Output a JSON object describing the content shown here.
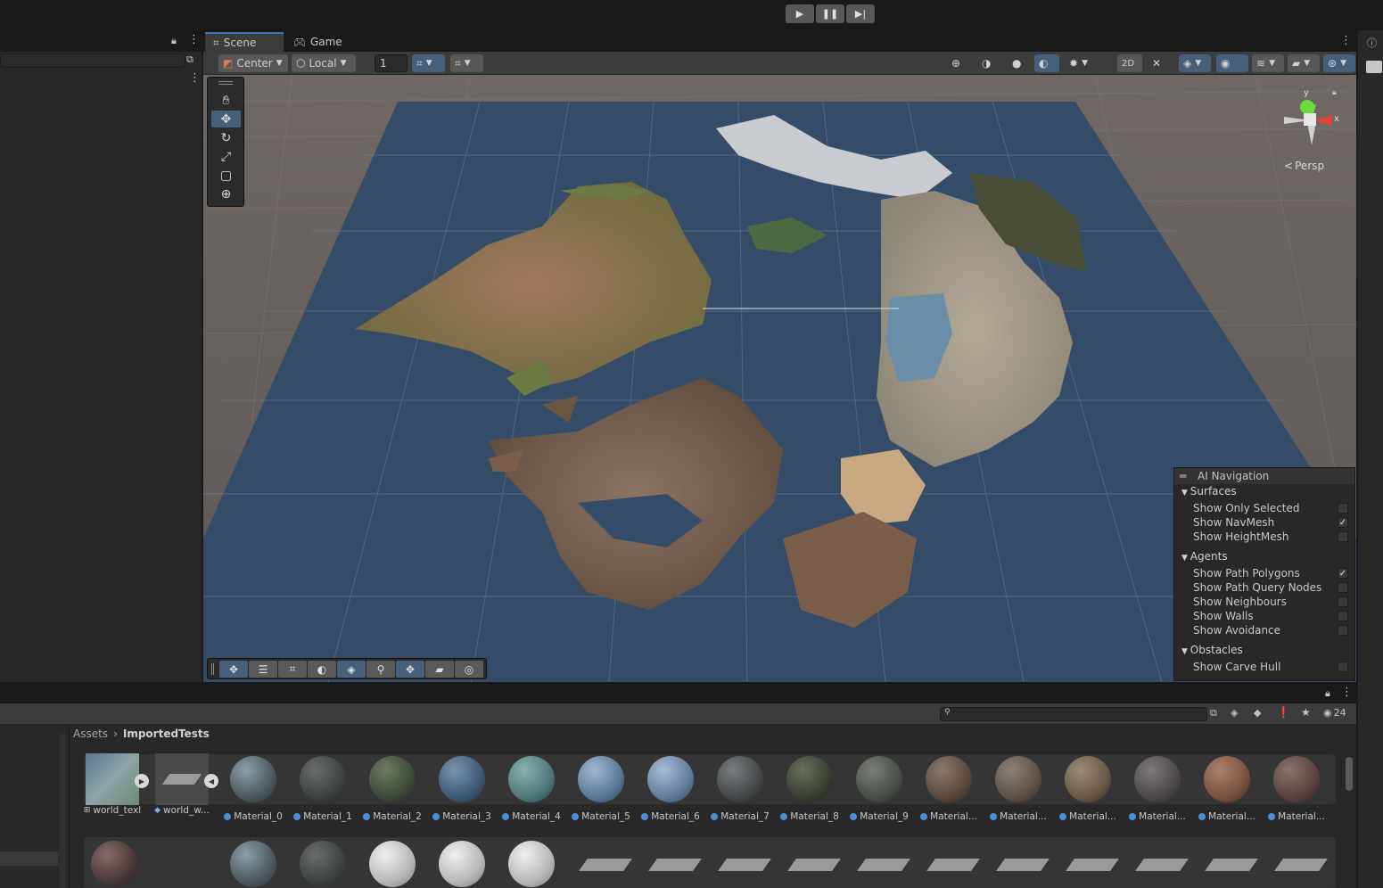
{
  "playbar": {
    "play": "▶",
    "pause": "❚❚",
    "step": "▶|"
  },
  "scene_tabs": [
    {
      "label": "Scene",
      "icon": "grid-icon"
    },
    {
      "label": "Game",
      "icon": "gamepad-icon"
    }
  ],
  "scene_toolbar": {
    "pivot": "Center",
    "space": "Local",
    "grid_value": "1"
  },
  "viewport": {
    "projection_label": "Persp",
    "axis_x": "x",
    "axis_y": "y"
  },
  "ai_navigation": {
    "title": "AI Navigation",
    "sections": [
      {
        "title": "Surfaces",
        "rows": [
          {
            "label": "Show Only Selected",
            "checked": false
          },
          {
            "label": "Show NavMesh",
            "checked": true
          },
          {
            "label": "Show HeightMesh",
            "checked": false
          }
        ]
      },
      {
        "title": "Agents",
        "rows": [
          {
            "label": "Show Path Polygons",
            "checked": true
          },
          {
            "label": "Show Path Query Nodes",
            "checked": false
          },
          {
            "label": "Show Neighbours",
            "checked": false
          },
          {
            "label": "Show Walls",
            "checked": false
          },
          {
            "label": "Show Avoidance",
            "checked": false
          }
        ]
      },
      {
        "title": "Obstacles",
        "rows": [
          {
            "label": "Show Carve Hull",
            "checked": false
          }
        ]
      }
    ]
  },
  "project": {
    "breadcrumb": [
      "Assets",
      "ImportedTests"
    ],
    "visible_count": "24",
    "assets_row1": [
      {
        "label": "world_texl",
        "kind": "texture"
      },
      {
        "label": "world_w...",
        "kind": "mesh"
      },
      {
        "label": "Material_0",
        "kind": "material",
        "color": "#4d5a5e"
      },
      {
        "label": "Material_1",
        "kind": "material",
        "color": "#3d4440"
      },
      {
        "label": "Material_2",
        "kind": "material",
        "color": "#3e4a3a"
      },
      {
        "label": "Material_3",
        "kind": "material",
        "color": "#3f5a75"
      },
      {
        "label": "Material_4",
        "kind": "material",
        "color": "#4f7a7c"
      },
      {
        "label": "Material_5",
        "kind": "material",
        "color": "#5b7a98"
      },
      {
        "label": "Material_6",
        "kind": "material",
        "color": "#637e9c"
      },
      {
        "label": "Material_7",
        "kind": "material",
        "color": "#45494a"
      },
      {
        "label": "Material_8",
        "kind": "material",
        "color": "#3a4032"
      },
      {
        "label": "Material_9",
        "kind": "material",
        "color": "#4a5048"
      },
      {
        "label": "Material...",
        "kind": "material",
        "color": "#5a4a3e"
      },
      {
        "label": "Material...",
        "kind": "material",
        "color": "#5e5248"
      },
      {
        "label": "Material...",
        "kind": "material",
        "color": "#6a5a48"
      },
      {
        "label": "Material...",
        "kind": "material",
        "color": "#4e4a4a"
      },
      {
        "label": "Material...",
        "kind": "material",
        "color": "#7a5240"
      },
      {
        "label": "Material...",
        "kind": "material",
        "color": "#5a4440"
      }
    ]
  }
}
